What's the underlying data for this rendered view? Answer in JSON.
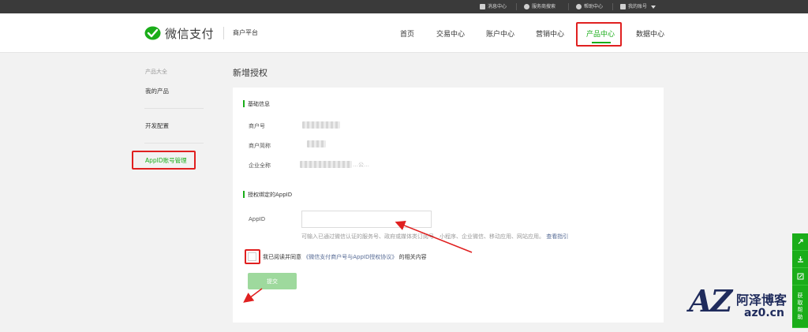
{
  "topbar": {
    "items": [
      {
        "label": "消息中心",
        "icon": "mail-icon"
      },
      {
        "label": "服务商搜索",
        "icon": "settings-icon"
      },
      {
        "label": "帮助中心",
        "icon": "help-icon"
      },
      {
        "label": "我的账号",
        "icon": "user-icon"
      }
    ]
  },
  "header": {
    "logo_text": "微信支付",
    "platform": "商户平台",
    "nav": [
      {
        "label": "首页"
      },
      {
        "label": "交易中心"
      },
      {
        "label": "账户中心"
      },
      {
        "label": "营销中心"
      },
      {
        "label": "产品中心"
      },
      {
        "label": "数据中心"
      }
    ],
    "active_nav": "产品中心"
  },
  "sidebar": {
    "title": "产品大全",
    "items": [
      {
        "label": "我的产品"
      },
      {
        "label": "开发配置"
      },
      {
        "label": "AppID账号管理"
      }
    ],
    "active": "AppID账号管理"
  },
  "main": {
    "page_title": "新增授权",
    "basic_section": {
      "title": "基础信息",
      "fields": [
        {
          "label": "商户号"
        },
        {
          "label": "商户简称"
        },
        {
          "label": "企业全称",
          "visible_value": "…公…"
        }
      ]
    },
    "appid_section": {
      "title": "授权绑定的AppID",
      "input_label": "AppID",
      "input_value": "",
      "hint_prefix": "可输入已通过微信认证的服务号、政府或媒体类订阅号、小程序、企业微信、移动应用、网站应用。",
      "hint_link": "查看指引"
    },
    "agreement": {
      "prefix": "我已阅读并同意",
      "link": "《微信支付商户号与AppID授权协议》",
      "suffix": "的相关内容",
      "checked": false
    },
    "submit_label": "提交"
  },
  "side_tools": {
    "items": [
      {
        "icon": "link-icon"
      },
      {
        "icon": "download-icon"
      },
      {
        "icon": "edit-icon"
      }
    ],
    "help_label": [
      "获",
      "取",
      "帮",
      "助"
    ]
  },
  "watermark": {
    "mark": "AZ",
    "name": "阿泽博客",
    "domain": "az0.cn"
  },
  "colors": {
    "brand_green": "#1aad19",
    "topbar": "#3a3a3a",
    "annotation_red": "#e02020",
    "link_blue": "#576b95"
  }
}
